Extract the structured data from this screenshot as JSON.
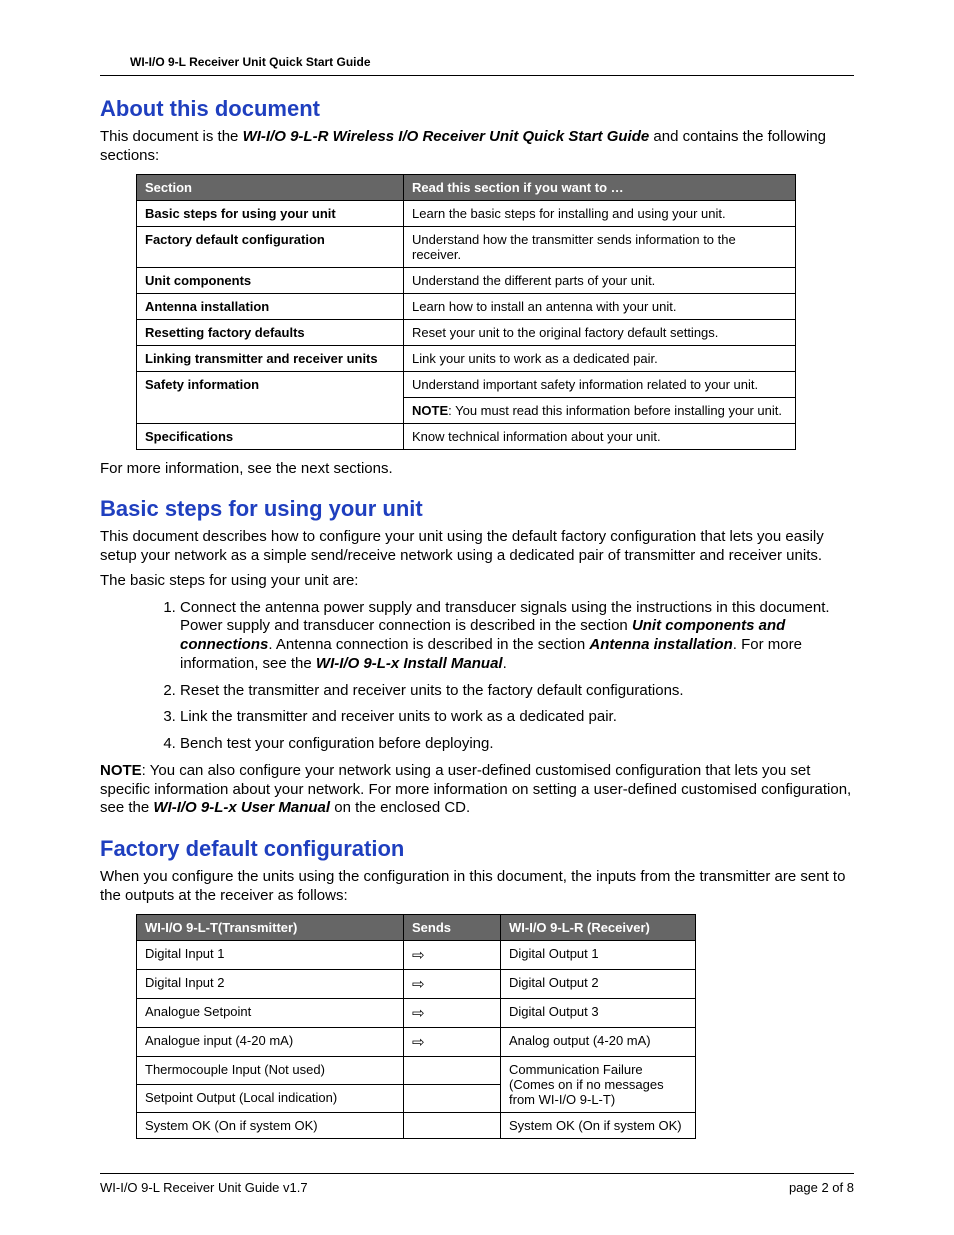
{
  "header": {
    "title": "WI-I/O 9-L Receiver Unit Quick Start Guide"
  },
  "about": {
    "heading": "About this document",
    "intro_pre": "This document is the ",
    "intro_bold": "WI-I/O 9-L-R Wireless I/O Receiver Unit Quick Start Guide",
    "intro_post": " and contains the following sections:",
    "table": {
      "col1": "Section",
      "col2": "Read this section if you want to …",
      "rows": [
        {
          "section": "Basic steps for using your unit",
          "desc": "Learn the basic steps for installing and using your unit."
        },
        {
          "section": "Factory default configuration",
          "desc": "Understand how the transmitter sends information to the receiver."
        },
        {
          "section": "Unit components",
          "desc": "Understand the different parts of your unit."
        },
        {
          "section": "Antenna installation",
          "desc": "Learn how to install an antenna with your unit."
        },
        {
          "section": "Resetting factory defaults",
          "desc": "Reset your unit to the original factory default settings."
        },
        {
          "section": "Linking transmitter and receiver units",
          "desc": "Link your units to work as a dedicated pair."
        },
        {
          "section": "Safety information",
          "desc": "Understand important safety information related to your unit.",
          "note_label": "NOTE",
          "note": ": You must read this information before installing your unit."
        },
        {
          "section": "Specifications",
          "desc": "Know technical information about your unit."
        }
      ]
    },
    "outro": "For more information, see the next sections."
  },
  "basic": {
    "heading": "Basic steps for using your unit",
    "intro": "This document describes how to configure your unit using the default factory configuration that lets you easily setup your network as a simple send/receive network using a dedicated pair of transmitter and receiver units.",
    "lead": "The basic steps for using your unit are:",
    "step1": {
      "pre": "Connect the antenna power supply and transducer signals using the instructions in this document. Power supply and transducer connection is described in the section ",
      "b1": "Unit components and connections",
      "mid": ". Antenna connection is described in the section ",
      "b2": "Antenna installation",
      "mid2": ". For more information, see the ",
      "b3": "WI-I/O 9-L-x Install Manual",
      "post": "."
    },
    "step2": "Reset the transmitter and receiver units to the factory default configurations.",
    "step3": "Link the transmitter and receiver units to work as a dedicated pair.",
    "step4": "Bench test your configuration before deploying.",
    "note_label": "NOTE",
    "note_pre": ": You can also configure your network using a user-defined customised configuration that lets you set specific information about your network. For more information on setting a user-defined customised configuration, see the ",
    "note_bold": "WI-I/O 9-L-x User Manual",
    "note_post": " on the enclosed CD."
  },
  "factory": {
    "heading": "Factory default configuration",
    "intro": "When you configure the units using the configuration in this document, the inputs from the transmitter are sent to the outputs at the receiver as follows:",
    "table": {
      "col1": "WI-I/O 9-L-T(Transmitter)",
      "col2": "Sends",
      "col3": "WI-I/O 9-L-R (Receiver)",
      "rows": [
        {
          "tx": "Digital Input 1",
          "arrow": "⇨",
          "rx": "Digital Output 1"
        },
        {
          "tx": "Digital Input 2",
          "arrow": "⇨",
          "rx": "Digital Output 2"
        },
        {
          "tx": "Analogue Setpoint",
          "arrow": "⇨",
          "rx": "Digital Output 3"
        },
        {
          "tx": "Analogue input (4-20 mA)",
          "arrow": "⇨",
          "rx": "Analog output (4-20 mA)"
        },
        {
          "tx": "Thermocouple Input (Not used)",
          "arrow": "",
          "rx": "Communication Failure (Comes on if no messages from WI-I/O 9-L-T)"
        },
        {
          "tx": "Setpoint Output (Local indication)",
          "arrow": "",
          "rx": ""
        },
        {
          "tx": "System OK (On if system OK)",
          "arrow": "",
          "rx": "System OK (On if system OK)"
        }
      ]
    }
  },
  "footer": {
    "left": "WI-I/O 9-L Receiver Unit Guide v1.7",
    "right": "page 2 of 8"
  }
}
